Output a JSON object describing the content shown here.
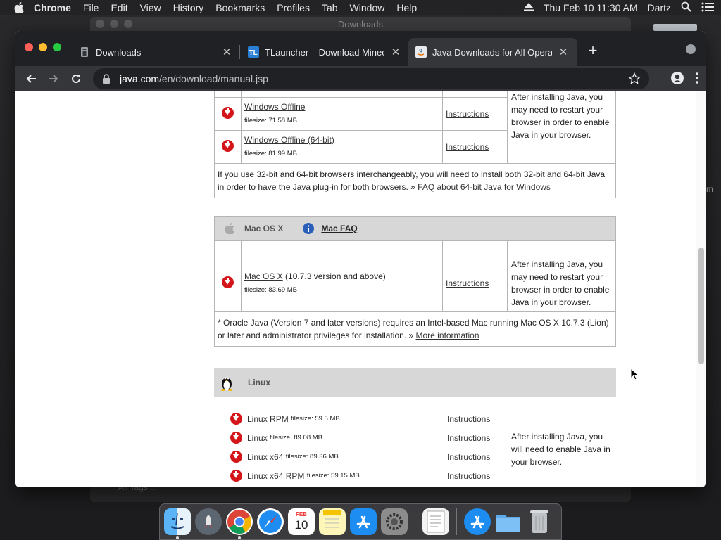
{
  "menubar": {
    "app": "Chrome",
    "items": [
      "File",
      "Edit",
      "View",
      "History",
      "Bookmarks",
      "Profiles",
      "Tab",
      "Window",
      "Help"
    ],
    "clock": "Thu Feb 10  11:30 AM",
    "user": "Dartz"
  },
  "background_window": {
    "title": "Downloads",
    "sidebar_text": "All Tags..."
  },
  "desktop_clip": "m",
  "browser": {
    "tabs": [
      {
        "title": "Downloads",
        "icon": "downloads-icon",
        "active": false
      },
      {
        "title": "TLauncher – Download Minecra",
        "icon": "tlauncher-icon",
        "active": false
      },
      {
        "title": "Java Downloads for All Operati",
        "icon": "java-icon",
        "active": true
      }
    ],
    "url_host": "java.com",
    "url_path": "/en/download/manual.jsp"
  },
  "page": {
    "windows": {
      "rows": [
        {
          "name": "Windows Offline",
          "filesize": "filesize: 71.58 MB",
          "instructions": "Instructions"
        },
        {
          "name": "Windows Offline (64-bit)",
          "filesize": "filesize: 81.99 MB",
          "instructions": "Instructions"
        }
      ],
      "note": "After installing Java, you may need to restart your browser in order to enable Java in your browser.",
      "footer_text": "If you use 32-bit and 64-bit browsers interchangeably, you will need to install both 32-bit and 64-bit Java in order to have the Java plug-in for both browsers. »",
      "footer_link": "FAQ about 64-bit Java for Windows"
    },
    "mac": {
      "heading": "Mac OS X",
      "faq": "Mac FAQ",
      "row": {
        "name": "Mac OS X",
        "suffix": " (10.7.3 version and above)",
        "filesize": "filesize: 83.69 MB",
        "instructions": "Instructions"
      },
      "note": "After installing Java, you may need to restart your browser in order to enable Java in your browser.",
      "footer_text": "* Oracle Java (Version 7 and later versions) requires an Intel-based Mac running Mac OS X 10.7.3 (Lion) or later and administrator privileges for installation. »",
      "footer_link": "More information"
    },
    "linux": {
      "heading": "Linux",
      "rows": [
        {
          "name": "Linux RPM",
          "filesize": "filesize: 59.5 MB",
          "instructions": "Instructions"
        },
        {
          "name": "Linux",
          "filesize": "filesize: 89.08 MB",
          "instructions": "Instructions"
        },
        {
          "name": "Linux x64",
          "filesize": "filesize: 89.36 MB",
          "instructions": "Instructions"
        },
        {
          "name": "Linux x64 RPM",
          "filesize": "filesize: 59.15 MB",
          "instructions": "Instructions"
        }
      ],
      "note": "After installing Java, you will need to enable Java in your browser."
    }
  },
  "dock": {
    "apps": [
      "finder-icon",
      "launchpad-icon",
      "chrome-icon",
      "safari-icon",
      "calendar-icon",
      "notes-icon",
      "app-store-icon",
      "system-preferences-icon",
      "textedit-icon",
      "app-store-folder-icon",
      "downloads-folder-icon",
      "trash-icon"
    ],
    "calendar_month": "FEB",
    "calendar_day": "10"
  },
  "colors": {
    "download_red": "#d4161a",
    "section_gray": "#d7d7d7",
    "chrome_dark": "#202124"
  }
}
